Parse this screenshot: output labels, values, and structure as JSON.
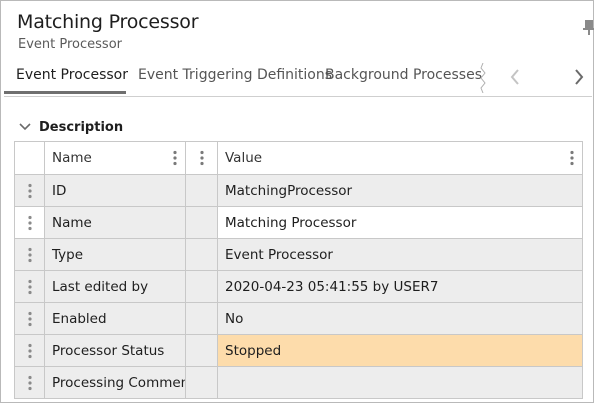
{
  "panel": {
    "title": "Matching Processor",
    "subtitle": "Event Processor"
  },
  "tabs": [
    {
      "label": "Event Processor",
      "active": true
    },
    {
      "label": "Event Triggering Definitions",
      "active": false
    },
    {
      "label": "Background Processes",
      "active": false
    }
  ],
  "section": {
    "label": "Description",
    "expanded": true
  },
  "grid": {
    "headers": {
      "name": "Name",
      "value": "Value"
    },
    "rows": [
      {
        "name": "ID",
        "value": "MatchingProcessor"
      },
      {
        "name": "Name",
        "value": "Matching Processor"
      },
      {
        "name": "Type",
        "value": "Event Processor"
      },
      {
        "name": "Last edited by",
        "value": "2020-04-23 05:41:55 by USER7"
      },
      {
        "name": "Enabled",
        "value": "No"
      },
      {
        "name": "Processor Status",
        "value": "Stopped"
      },
      {
        "name": "Processing Comment",
        "value": ""
      }
    ]
  },
  "colors": {
    "highlight": "#fddcab",
    "readonly_cell": "#ededed",
    "border": "#c8c8c8"
  },
  "icons": [
    "pin-icon",
    "chevron-left-icon",
    "chevron-right-icon",
    "chevron-down-icon",
    "drag-handle-icon",
    "column-menu-icon"
  ]
}
